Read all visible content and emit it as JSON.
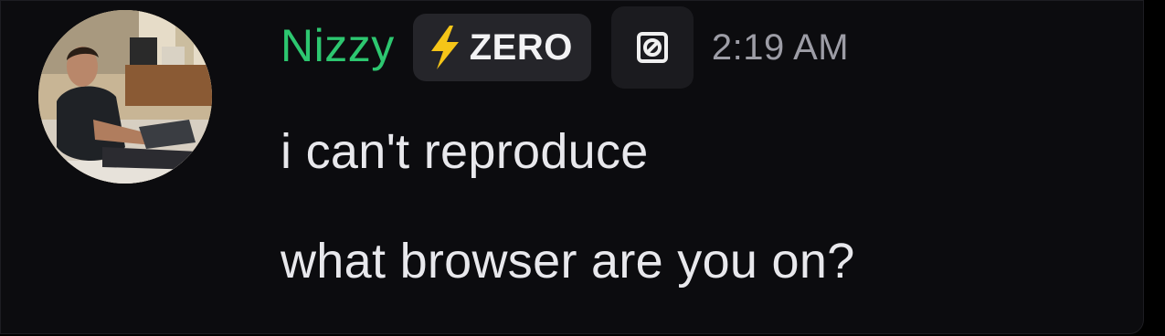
{
  "message": {
    "author": {
      "name": "Nizzy",
      "name_color": "#2dc770",
      "avatar": "user-avatar-photo"
    },
    "tag": {
      "icon": "lightning-bolt-icon",
      "label": "ZERO",
      "icon_color": "#f5c518"
    },
    "app_badge": {
      "icon": "app-badge-icon"
    },
    "timestamp": "2:19 AM",
    "lines": [
      "i can't reproduce",
      "what browser are you on?"
    ]
  }
}
